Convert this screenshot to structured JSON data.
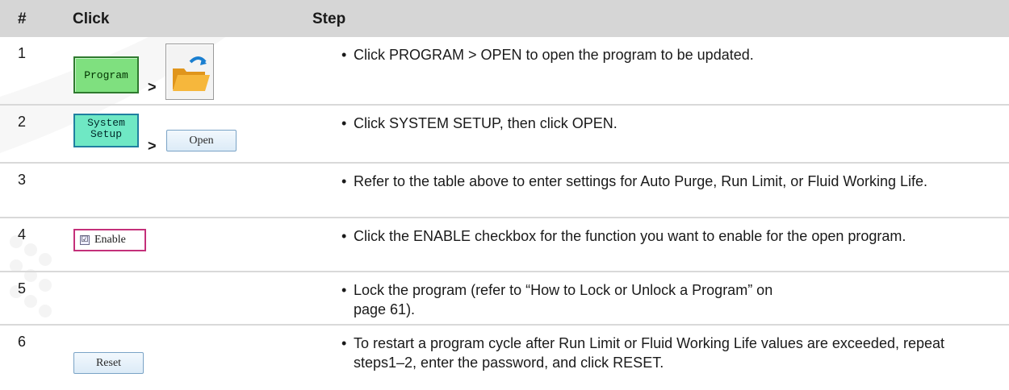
{
  "table": {
    "headers": {
      "num": "#",
      "click": "Click",
      "step": "Step"
    },
    "bullet": "•",
    "separator": ">",
    "rows": [
      {
        "num": "1",
        "step": "Click PROGRAM > OPEN to open the program to be updated.",
        "buttons": {
          "program": "Program",
          "folder_icon": "open-folder-icon"
        }
      },
      {
        "num": "2",
        "step": "Click SYSTEM SETUP, then click OPEN.",
        "buttons": {
          "system_line1": "System",
          "system_line2": "Setup",
          "open": "Open"
        }
      },
      {
        "num": "3",
        "step": "Refer to the table above to enter settings for Auto Purge, Run Limit, or Fluid Working Life."
      },
      {
        "num": "4",
        "step": "Click the ENABLE checkbox for the function you want to enable for the open program.",
        "buttons": {
          "enable": "Enable",
          "check": "☑"
        }
      },
      {
        "num": "5",
        "step": "Lock the program (refer to “How to Lock or Unlock a Program” on page 61)."
      },
      {
        "num": "6",
        "step": "To restart a program cycle after Run Limit or Fluid Working Life values are exceeded, repeat steps1–2, enter the password, and click RESET.",
        "buttons": {
          "reset": "Reset"
        }
      }
    ]
  }
}
